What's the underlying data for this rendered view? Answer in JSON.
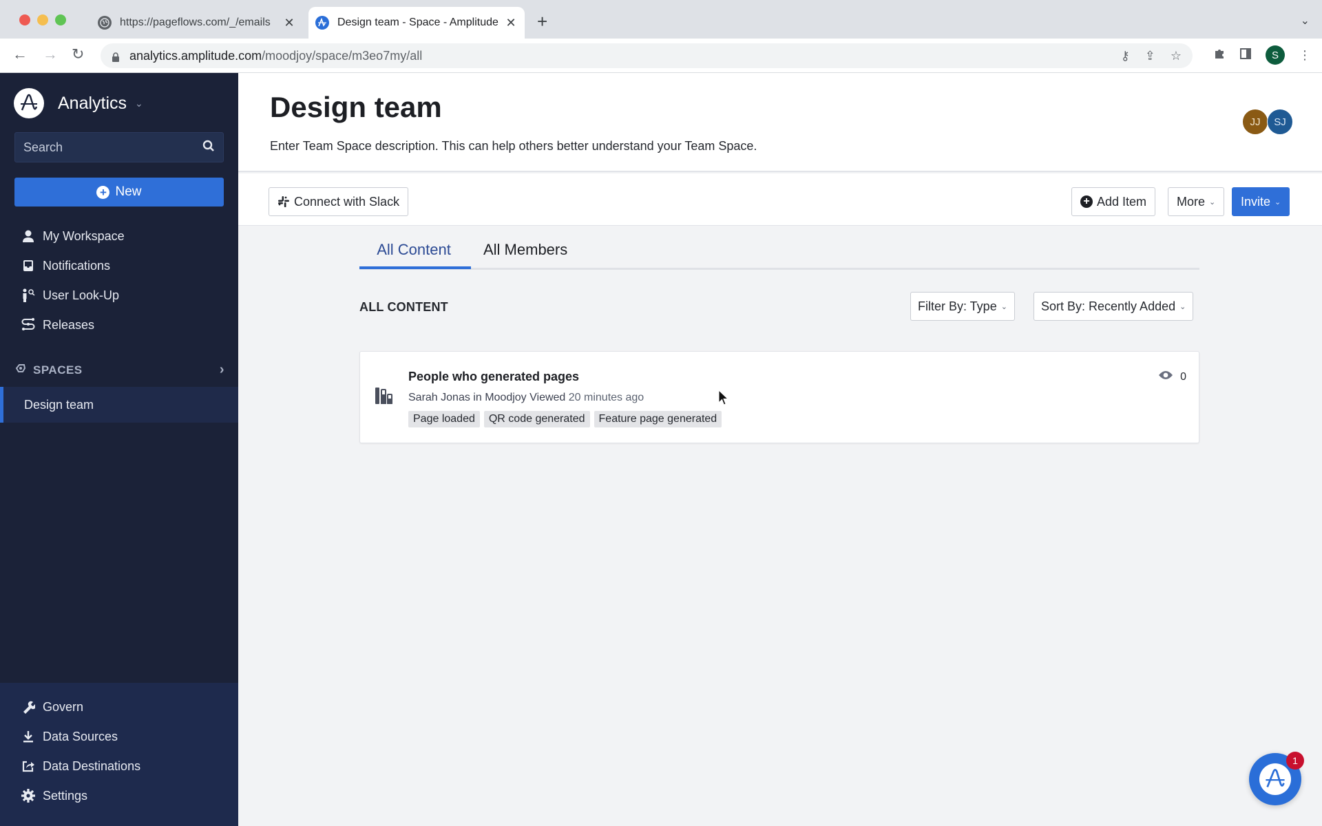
{
  "browser": {
    "tabs": [
      {
        "title": "https://pageflows.com/_/emails",
        "icon": "globe-icon",
        "active": false
      },
      {
        "title": "Design team - Space - Amplitude",
        "icon": "amplitude-icon",
        "active": true
      }
    ],
    "url_host": "analytics.amplitude.com",
    "url_path": "/moodjoy/space/m3eo7my/all",
    "profile_initial": "S"
  },
  "sidebar": {
    "brand": "Analytics",
    "search_placeholder": "Search",
    "new_label": "New",
    "nav_items": [
      {
        "label": "My Workspace",
        "icon": "user-icon"
      },
      {
        "label": "Notifications",
        "icon": "inbox-icon"
      },
      {
        "label": "User Look-Up",
        "icon": "user-lookup-icon"
      },
      {
        "label": "Releases",
        "icon": "releases-icon"
      }
    ],
    "spaces_header": "SPACES",
    "spaces": [
      {
        "label": "Design team",
        "active": true
      }
    ],
    "bottom_items": [
      {
        "label": "Govern",
        "icon": "wrench-icon"
      },
      {
        "label": "Data Sources",
        "icon": "download-icon"
      },
      {
        "label": "Data Destinations",
        "icon": "export-icon"
      },
      {
        "label": "Settings",
        "icon": "gear-icon"
      }
    ]
  },
  "header": {
    "title": "Design team",
    "description": "Enter Team Space description. This can help others better understand your Team Space.",
    "members": [
      {
        "initials": "JJ",
        "color": "#8a5a14"
      },
      {
        "initials": "SJ",
        "color": "#1f5a94"
      }
    ]
  },
  "actions": {
    "connect_slack": "Connect with Slack",
    "add_item": "Add Item",
    "more": "More",
    "invite": "Invite"
  },
  "tabs": [
    {
      "label": "All Content",
      "active": true
    },
    {
      "label": "All Members",
      "active": false
    }
  ],
  "content": {
    "section_label": "ALL CONTENT",
    "filter_label": "Filter By: Type",
    "sort_label": "Sort By: Recently Added",
    "items": [
      {
        "title": "People who generated pages",
        "owner": "Sarah Jonas",
        "in_word": "in",
        "project": "Moodjoy",
        "viewed_label": "Viewed",
        "viewed_time": "20 minutes ago",
        "tags": [
          "Page loaded",
          "QR code generated",
          "Feature page generated"
        ],
        "views": "0",
        "icon": "bar-chart-icon"
      }
    ]
  },
  "help": {
    "badge_count": "1"
  },
  "colors": {
    "accent": "#2f6fd8",
    "sidebar_bg": "#1b2238",
    "badge": "#c8102e"
  }
}
